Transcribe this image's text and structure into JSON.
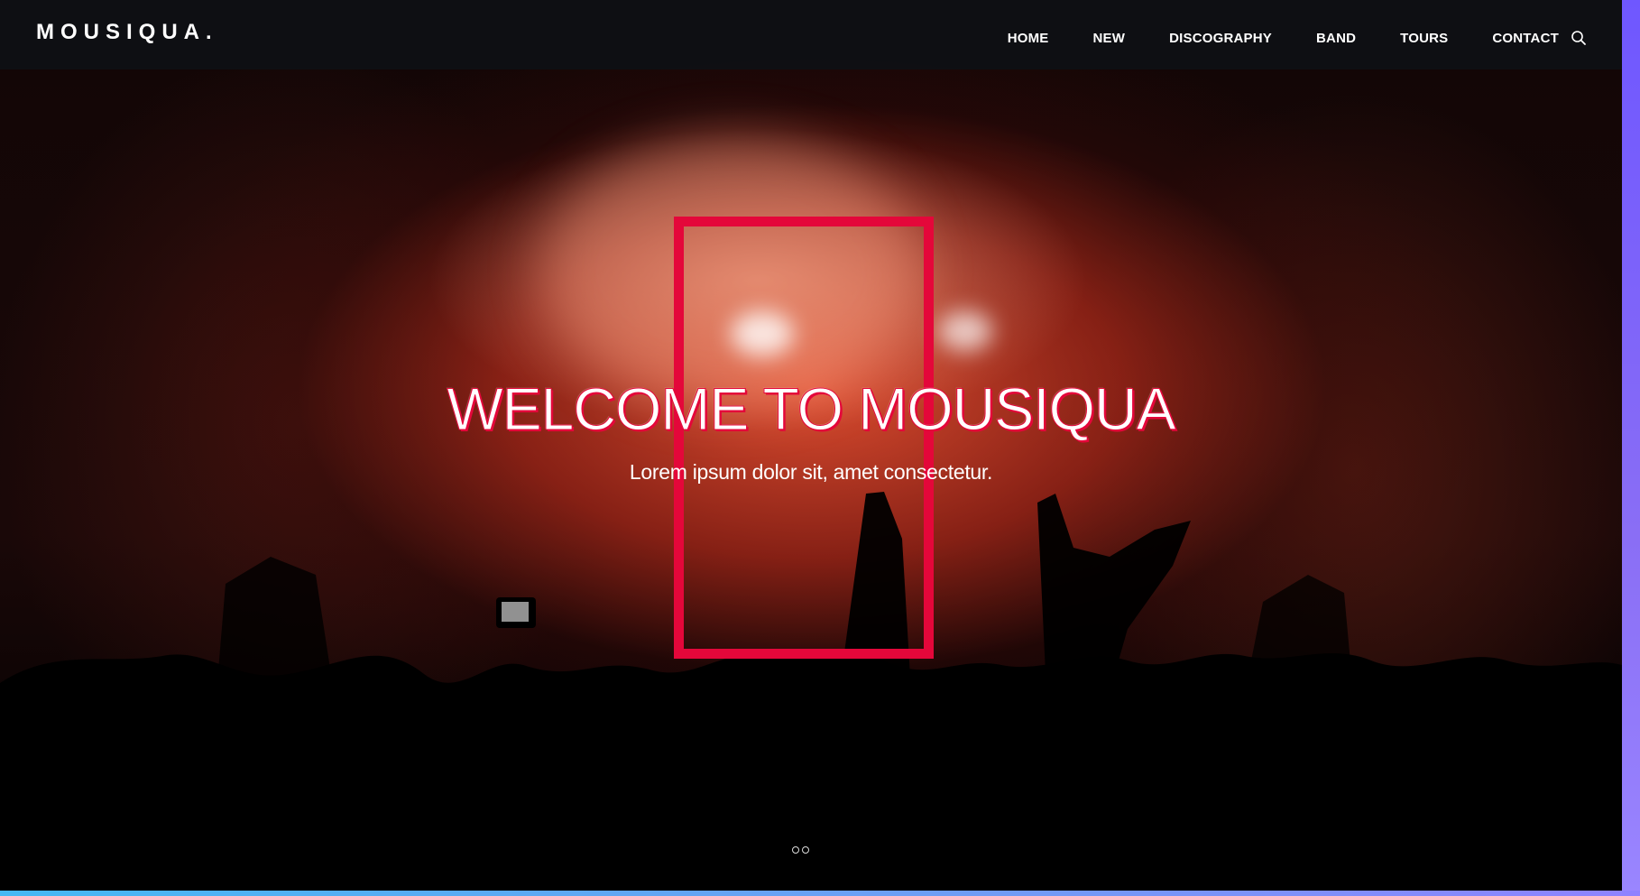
{
  "header": {
    "logo": "MOUSIQUA.",
    "nav": [
      "HOME",
      "NEW",
      "DISCOGRAPHY",
      "BAND",
      "TOURS",
      "CONTACT"
    ],
    "search_icon": "search-icon"
  },
  "hero": {
    "title": "WELCOME TO MOUSIQUA",
    "subtitle": "Lorem ipsum dolor sit, amet consectetur.",
    "accent_color": "#e4073a",
    "slides": 2
  },
  "colors": {
    "topbar": "#0e1014",
    "frame": "#e4073a",
    "side_strip": "#7b63fb",
    "bottom_strip": "#45b8f3"
  }
}
